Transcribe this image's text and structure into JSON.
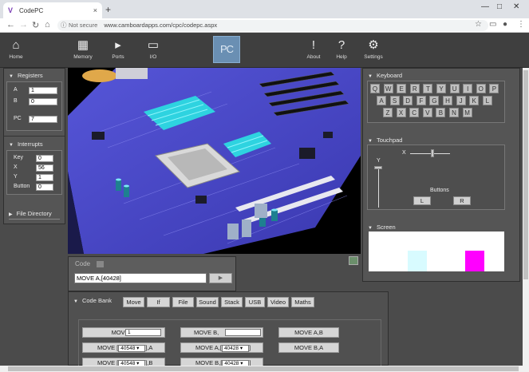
{
  "browser": {
    "tab_title": "CodePC",
    "tab_close": "×",
    "new_tab": "+",
    "url_status": "Not secure",
    "url": "www.camboardapps.com/cpc/codepc.aspx"
  },
  "toolbar": {
    "items": [
      {
        "label": "Home",
        "icon": "home-icon"
      },
      {
        "label": "Memory",
        "icon": "memory-icon"
      },
      {
        "label": "Ports",
        "icon": "speaker-icon"
      },
      {
        "label": "I/O",
        "icon": "monitor-icon"
      },
      {
        "label": "About",
        "icon": "exclamation-icon"
      },
      {
        "label": "Help",
        "icon": "question-icon"
      },
      {
        "label": "Settings",
        "icon": "gears-icon"
      }
    ],
    "logo_text": "PC"
  },
  "registers": {
    "title": "Registers",
    "rows": [
      {
        "label": "A",
        "value": "1"
      },
      {
        "label": "B",
        "value": "0"
      },
      {
        "label": "PC",
        "value": "7"
      }
    ]
  },
  "interrupts": {
    "title": "Interrupts",
    "rows": [
      {
        "label": "Key",
        "value": "0"
      },
      {
        "label": "X",
        "value": "56"
      },
      {
        "label": "Y",
        "value": "1"
      },
      {
        "label": "Button",
        "value": "0"
      }
    ]
  },
  "file_directory": {
    "title": "File Directory"
  },
  "keyboard": {
    "title": "Keyboard",
    "rows": [
      [
        "Q",
        "W",
        "E",
        "R",
        "T",
        "Y",
        "U",
        "I",
        "O",
        "P"
      ],
      [
        "A",
        "S",
        "D",
        "F",
        "G",
        "H",
        "J",
        "K",
        "L"
      ],
      [
        "Z",
        "X",
        "C",
        "V",
        "B",
        "N",
        "M"
      ]
    ]
  },
  "touchpad": {
    "title": "Touchpad",
    "x_label": "X",
    "y_label": "Y",
    "x_value": 0.55,
    "y_value": 0.0,
    "buttons_label": "Buttons",
    "left": "L",
    "right": "R"
  },
  "screen": {
    "title": "Screen",
    "color_cyan": "#d8fbff",
    "color_magenta": "#ff00ff"
  },
  "code": {
    "title": "Code",
    "input_value": "MOVE A,[40428]"
  },
  "code_bank": {
    "title": "Code Bank",
    "tabs": [
      "Move",
      "If",
      "File",
      "Sound",
      "Stack",
      "USB",
      "Video",
      "Maths"
    ],
    "rows": [
      [
        {
          "label": "MOVE A,",
          "field": "1"
        },
        {
          "label": "MOVE B,",
          "field": ""
        },
        {
          "label": "MOVE A,B"
        }
      ],
      [
        {
          "prefix": "MOVE [",
          "select": "40548",
          "suffix": "],A"
        },
        {
          "prefix": "MOVE A,[",
          "select": "40428",
          "suffix": "]"
        },
        {
          "label": "MOVE B,A"
        }
      ],
      [
        {
          "prefix": "MOVE [",
          "select": "40548",
          "suffix": "],B"
        },
        {
          "prefix": "MOVE B,[",
          "select": "40428",
          "suffix": "]"
        }
      ]
    ]
  }
}
